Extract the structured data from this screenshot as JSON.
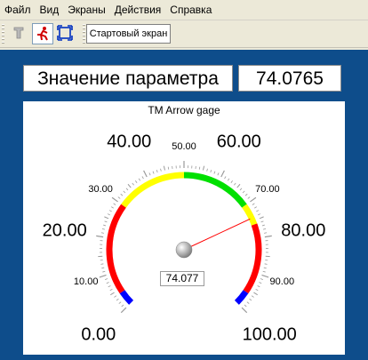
{
  "menu": [
    "Файл",
    "Вид",
    "Экраны",
    "Действия",
    "Справка"
  ],
  "toolbar": {
    "icons": [
      "tool-icon",
      "runner-icon",
      "fullscreen-icon"
    ],
    "screen_button": "Стартовый экран"
  },
  "param": {
    "label": "Значение параметра",
    "value": "74.0765"
  },
  "gauge": {
    "title": "TM Arrow gage",
    "value": 74.0765,
    "value_display": "74.077",
    "min": 0,
    "max": 100,
    "major_labels": [
      "0.00",
      "20.00",
      "40.00",
      "60.00",
      "80.00",
      "100.00"
    ],
    "minor_labels": [
      "10.00",
      "30.00",
      "50.00",
      "70.00",
      "90.00"
    ],
    "zones": [
      {
        "from": 0,
        "to": 4,
        "color": "#0000ff"
      },
      {
        "from": 4,
        "to": 30,
        "color": "#ff0000"
      },
      {
        "from": 30,
        "to": 50,
        "color": "#ffff00"
      },
      {
        "from": 50,
        "to": 70,
        "color": "#00e000"
      },
      {
        "from": 70,
        "to": 76,
        "color": "#ffff00"
      },
      {
        "from": 76,
        "to": 96,
        "color": "#ff0000"
      },
      {
        "from": 96,
        "to": 100,
        "color": "#0000ff"
      }
    ],
    "needle_color": "#ff0000"
  }
}
